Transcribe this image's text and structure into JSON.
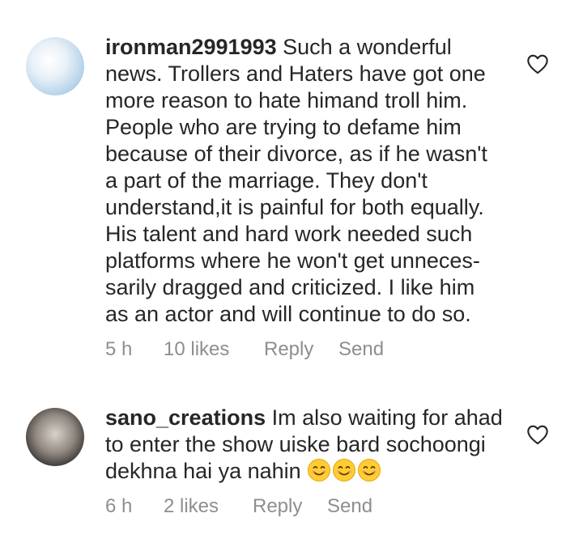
{
  "comments": [
    {
      "username": "ironman2991993",
      "lines": [
        "Such a wonderful",
        "news. Trollers and Haters have got one",
        "more reason to hate himand troll him.",
        "People who are trying to defame him",
        "because of their divorce, as if he wasn't",
        "a part of the marriage. They don't",
        "understand,it is painful for both equally.",
        "His talent and hard work needed such",
        "platforms where he won't get unneces-",
        "sarily dragged and criticized. I like him",
        "as an actor and will continue to do so."
      ],
      "time": "5 h",
      "likes": "10 likes",
      "reply_label": "Reply",
      "send_label": "Send"
    },
    {
      "username": "sano_creations",
      "lines": [
        "Im also waiting for ahad",
        "to enter the show uiske bard sochoongi",
        "dekhna hai ya nahin"
      ],
      "emojis": "😊😊😊",
      "time": "6 h",
      "likes": "2 likes",
      "reply_label": "Reply",
      "send_label": "Send"
    }
  ],
  "icons": {
    "heart": "heart-outline-icon",
    "smile": "smiling-face-emoji"
  },
  "colors": {
    "text": "#262626",
    "meta": "#8e8e8e",
    "emoji": "#ffcc33"
  }
}
